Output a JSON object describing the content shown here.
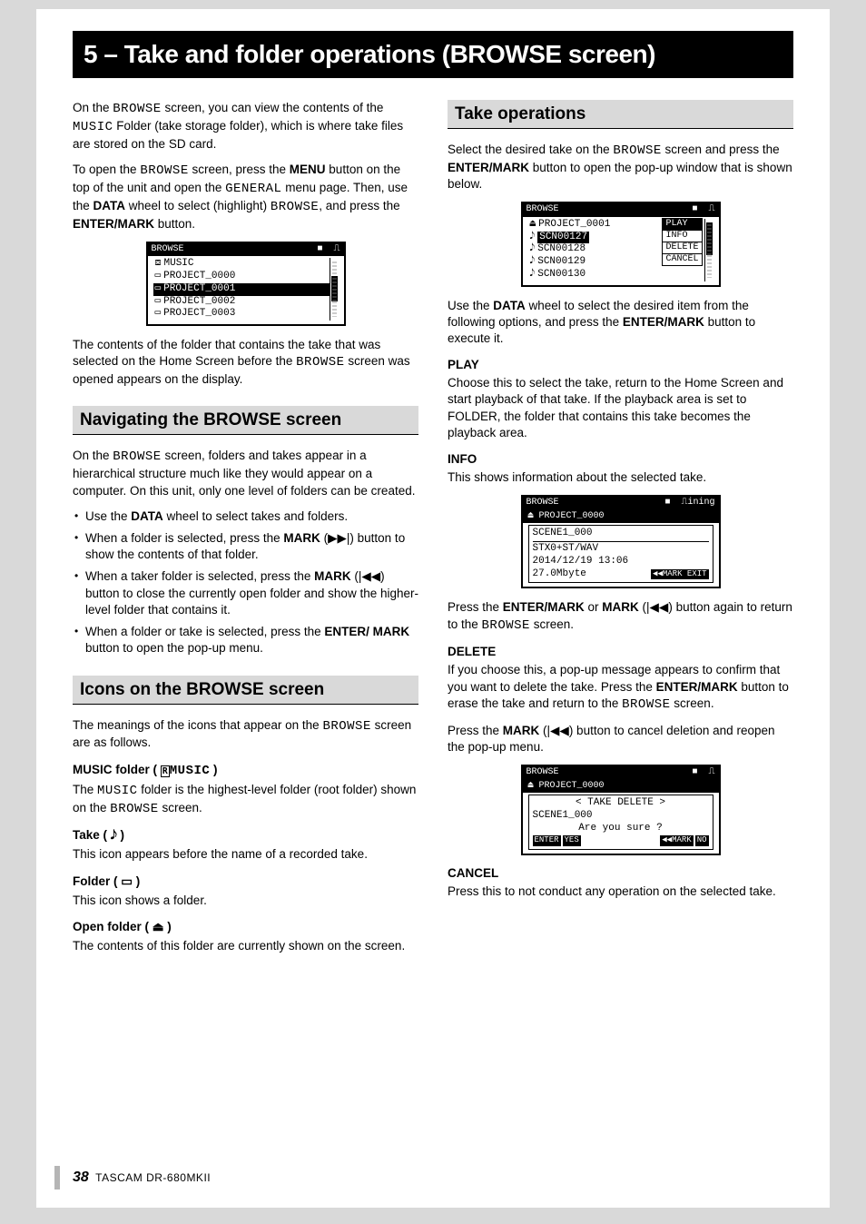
{
  "page": {
    "title": "5 – Take and folder operations (BROWSE screen)",
    "footer_num": "38",
    "footer_prod": "TASCAM  DR-680MKII"
  },
  "left": {
    "p1_a": "On the ",
    "p1_b": " screen, you can view the contents of the ",
    "p1_c": " Folder (take storage folder), which is where take files are stored on the SD card.",
    "p2_a": "To open the ",
    "p2_b": " screen, press the ",
    "p2_c": " button on the top of the unit and open the ",
    "p2_d": " menu page. Then, use the ",
    "p2_e": " wheel to select (highlight) ",
    "p2_f": ", and press the ",
    "p2_g": " button.",
    "lcd1": {
      "title": "BROWSE",
      "rows": [
        {
          "sel": false,
          "icon": "root-icon",
          "text": "MUSIC"
        },
        {
          "sel": false,
          "icon": "folder-icon",
          "text": "PROJECT_0000"
        },
        {
          "sel": true,
          "icon": "folder-icon",
          "text": "PROJECT_0001"
        },
        {
          "sel": false,
          "icon": "folder-icon",
          "text": "PROJECT_0002"
        },
        {
          "sel": false,
          "icon": "folder-icon",
          "text": "PROJECT_0003"
        }
      ]
    },
    "p3_a": "The contents of the folder that contains the take that was selected on the Home Screen before the ",
    "p3_b": " screen was opened appears on the display.",
    "nav_head": "Navigating the BROWSE screen",
    "nav_p1_a": "On the ",
    "nav_p1_b": " screen, folders and takes appear in a hierarchical structure much like they would appear on a computer. On this unit, only one level of folders can be created.",
    "bul1_a": "Use the ",
    "bul1_b": " wheel to select takes and folders.",
    "bul2_a": "When a folder is selected, press the ",
    "bul2_b": " (",
    "bul2_c": ") button to show the contents of that folder.",
    "bul3_a": "When a taker folder is selected, press the ",
    "bul3_b": " (",
    "bul3_c": ") button to close the currently open folder and show the higher-level folder that contains it.",
    "bul4_a": "When a folder or take is selected, press the ",
    "bul4_b": " button to open the pop-up menu.",
    "icons_head": "Icons on the BROWSE screen",
    "icons_p1_a": "The meanings of the icons that appear on the ",
    "icons_p1_b": " screen are as follows.",
    "music_head_a": "MUSIC folder ( ",
    "music_head_b": " )",
    "music_label": "MUSIC",
    "music_p_a": "The ",
    "music_p_b": " folder is the highest-level folder (root folder) shown on the ",
    "music_p_c": " screen.",
    "take_head": "Take ( 𝅘𝅥𝅮 )",
    "take_p": "This icon appears before the name of a recorded take.",
    "folder_head": "Folder ( ▭ )",
    "folder_p": "This icon shows a folder.",
    "open_head": "Open folder ( ⏏ )",
    "open_p": "The contents of this folder are currently shown on the screen."
  },
  "right": {
    "head": "Take operations",
    "p1_a": "Select the desired take on the ",
    "p1_b": " screen and press the ",
    "p1_c": " button to open the pop-up window that is shown below.",
    "lcd2": {
      "title": "BROWSE",
      "parent": "PROJECT_0001",
      "rows": [
        {
          "sel": true,
          "text": "SCN00127"
        },
        {
          "sel": false,
          "text": "SCN00128"
        },
        {
          "sel": false,
          "text": "SCN00129"
        },
        {
          "sel": false,
          "text": "SCN00130"
        }
      ],
      "popup": [
        "PLAY",
        "INFO",
        "DELETE",
        "CANCEL"
      ],
      "popup_sel": 0
    },
    "p2_a": "Use the ",
    "p2_b": " wheel to select the desired item from the following options, and press the ",
    "p2_c": " button to execute it.",
    "play_h": "PLAY",
    "play_p": "Choose this to select the take, return to the Home Screen and start playback of that take. If the playback area is set to FOLDER, the folder that contains this take becomes the playback area.",
    "info_h": "INFO",
    "info_p": "This shows information about the selected take.",
    "lcd3": {
      "title": "BROWSE",
      "parent": "PROJECT_0000",
      "box_title": "SCENE1_000",
      "lines": [
        "STX0+ST/WAV",
        "2014/12/19 13:06"
      ],
      "size": "27.0Mbyte",
      "exit": "◀◀MARK EXIT"
    },
    "p3_a": "Press the ",
    "p3_b": " or ",
    "p3_c": " (",
    "p3_d": ") button again to return to the ",
    "p3_e": " screen.",
    "del_h": "DELETE",
    "del_p1_a": "If you choose this, a pop-up message appears to confirm that you want to delete the take. Press the ",
    "del_p1_b": " button to erase the take and return to the ",
    "del_p1_c": " screen.",
    "del_p2_a": "Press the ",
    "del_p2_b": " (",
    "del_p2_c": ") button to cancel deletion and reopen the pop-up menu.",
    "lcd4": {
      "title": "BROWSE",
      "parent": "PROJECT_0000",
      "line1": "< TAKE DELETE >",
      "line2": "SCENE1_000",
      "line3": "Are you sure ?",
      "yes": "ENTER YES",
      "no": "◀◀MARK NO"
    },
    "cancel_h": "CANCEL",
    "cancel_p": "Press this to not conduct any operation on the selected take."
  },
  "kw": {
    "BROWSE": "BROWSE",
    "MUSIC": "MUSIC",
    "GENERAL": "GENERAL",
    "MENU": "MENU",
    "DATA": "DATA",
    "ENTER_MARK": "ENTER/MARK",
    "MARK": "MARK",
    "ENTER_MARK_SLASH": "ENTER/ MARK"
  }
}
